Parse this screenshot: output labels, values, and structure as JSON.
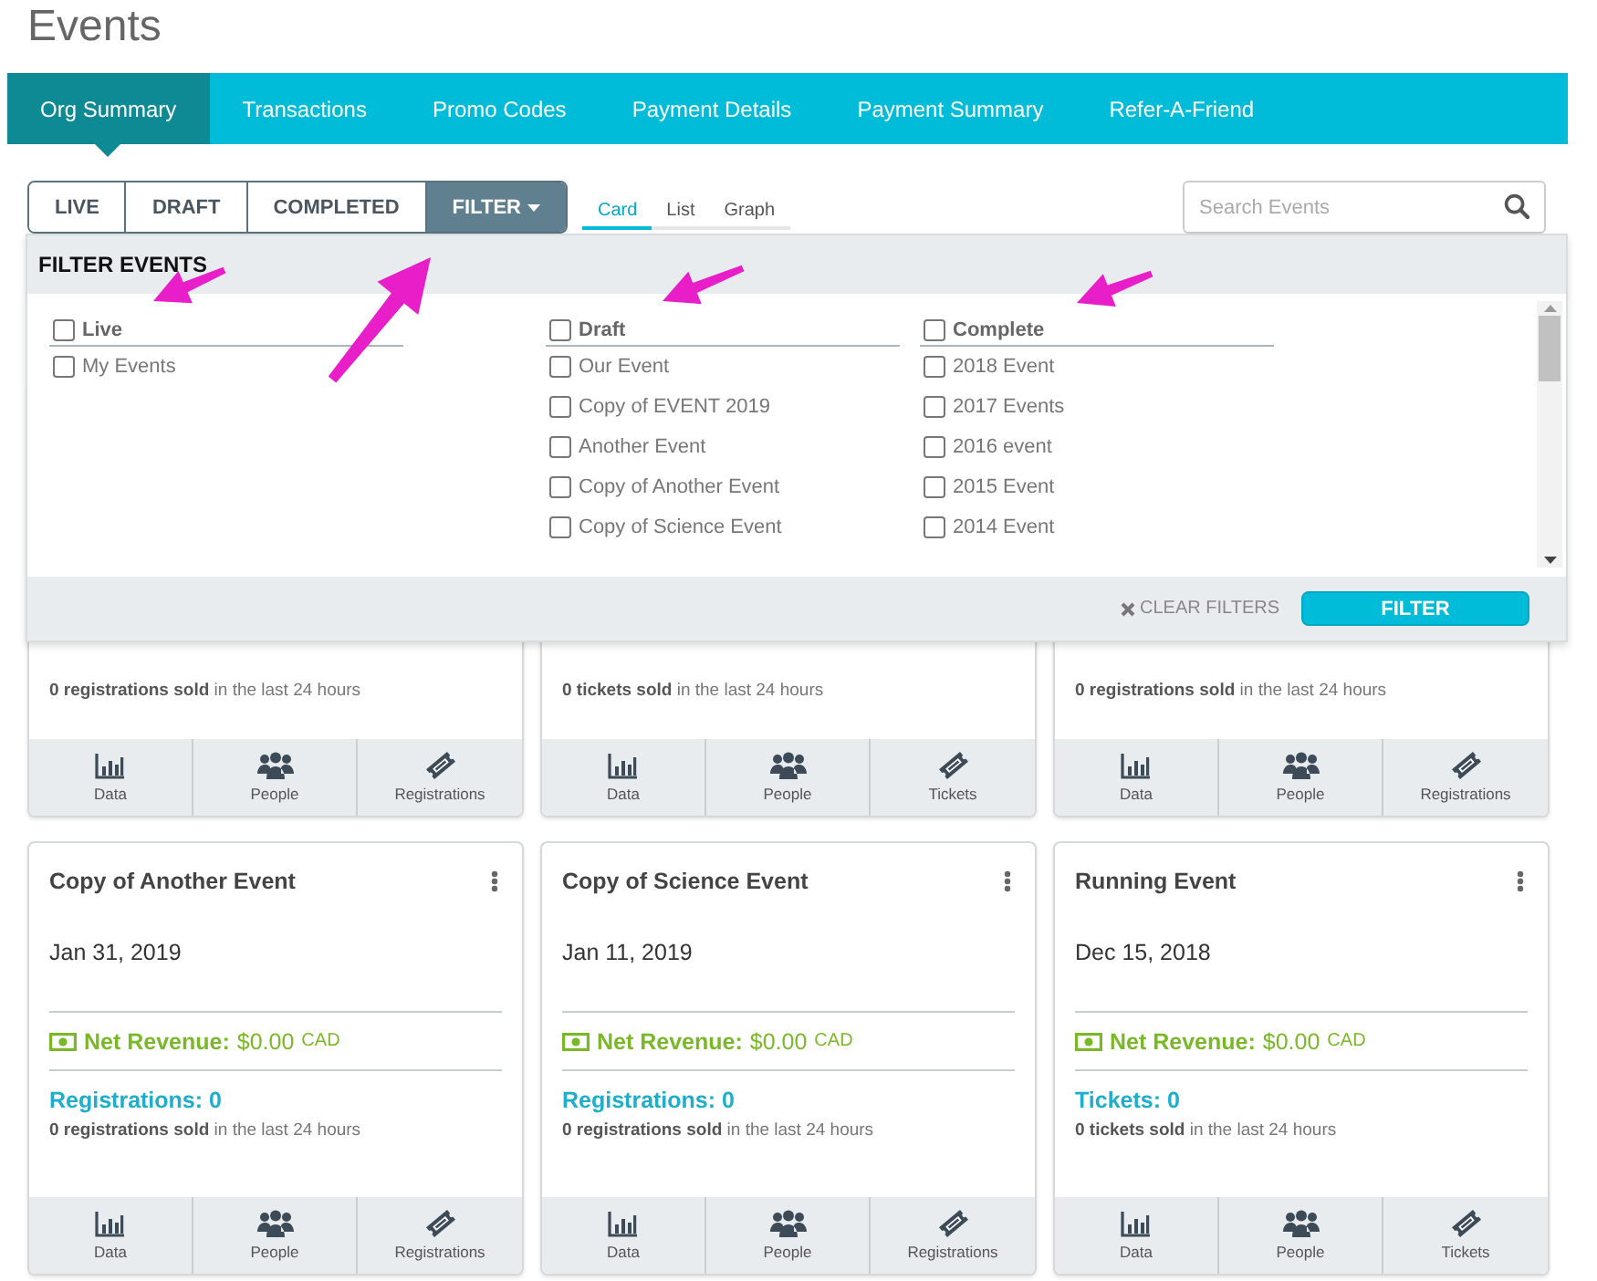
{
  "page_title": "Events",
  "nav_tabs": [
    {
      "label": "Org Summary",
      "selected": true
    },
    {
      "label": "Transactions",
      "selected": false
    },
    {
      "label": "Promo Codes",
      "selected": false
    },
    {
      "label": "Payment Details",
      "selected": false
    },
    {
      "label": "Payment Summary",
      "selected": false
    },
    {
      "label": "Refer-A-Friend",
      "selected": false
    }
  ],
  "status_buttons": [
    {
      "label": "LIVE",
      "selected": false
    },
    {
      "label": "DRAFT",
      "selected": false
    },
    {
      "label": "COMPLETED",
      "selected": false
    }
  ],
  "filter_button": {
    "label": "FILTER",
    "expanded": true
  },
  "view_tabs": [
    {
      "label": "Card",
      "selected": true
    },
    {
      "label": "List",
      "selected": false
    },
    {
      "label": "Graph",
      "selected": false
    }
  ],
  "search": {
    "placeholder": "Search Events"
  },
  "filter_panel": {
    "title": "FILTER EVENTS",
    "clear_label": "CLEAR FILTERS",
    "apply_label": "FILTER",
    "groups": [
      {
        "label": "Live",
        "checked": false,
        "items": [
          {
            "label": "My Events",
            "checked": false
          }
        ]
      },
      {
        "label": "Draft",
        "checked": false,
        "items": [
          {
            "label": "Our Event",
            "checked": false
          },
          {
            "label": "Copy of EVENT 2019",
            "checked": false
          },
          {
            "label": "Another Event",
            "checked": false
          },
          {
            "label": "Copy of Another Event",
            "checked": false
          },
          {
            "label": "Copy of Science Event",
            "checked": false
          }
        ]
      },
      {
        "label": "Complete",
        "checked": false,
        "items": [
          {
            "label": "2018 Event",
            "checked": false
          },
          {
            "label": "2017 Events",
            "checked": false
          },
          {
            "label": "2016 event",
            "checked": false
          },
          {
            "label": "2015 Event",
            "checked": false
          },
          {
            "label": "2014 Event",
            "checked": false
          }
        ]
      }
    ]
  },
  "cards": [
    {
      "sold": "**0 registrations sold** in the last 24 hours",
      "actions": [
        {
          "label": "Data",
          "kind": "chart"
        },
        {
          "label": "People",
          "kind": "people"
        },
        {
          "label": "Registrations",
          "kind": "ticket"
        }
      ]
    },
    {
      "sold": "**0 tickets sold** in the last 24 hours",
      "actions": [
        {
          "label": "Data",
          "kind": "chart"
        },
        {
          "label": "People",
          "kind": "people"
        },
        {
          "label": "Tickets",
          "kind": "ticket"
        }
      ]
    },
    {
      "sold": "**0 registrations sold** in the last 24 hours",
      "actions": [
        {
          "label": "Data",
          "kind": "chart"
        },
        {
          "label": "People",
          "kind": "people"
        },
        {
          "label": "Registrations",
          "kind": "ticket"
        }
      ]
    },
    {
      "title": "Copy of Another Event",
      "date": "Jan 31, 2019",
      "revenue_label": "Net Revenue:",
      "revenue_amount": "$0.00",
      "currency": "CAD",
      "count": "Registrations: 0",
      "sold": "**0 registrations sold** in the last 24 hours",
      "actions": [
        {
          "label": "Data",
          "kind": "chart"
        },
        {
          "label": "People",
          "kind": "people"
        },
        {
          "label": "Registrations",
          "kind": "ticket"
        }
      ]
    },
    {
      "title": "Copy of Science Event",
      "date": "Jan 11, 2019",
      "revenue_label": "Net Revenue:",
      "revenue_amount": "$0.00",
      "currency": "CAD",
      "count": "Registrations: 0",
      "sold": "**0 registrations sold** in the last 24 hours",
      "actions": [
        {
          "label": "Data",
          "kind": "chart"
        },
        {
          "label": "People",
          "kind": "people"
        },
        {
          "label": "Registrations",
          "kind": "ticket"
        }
      ]
    },
    {
      "title": "Running Event",
      "date": "Dec 15, 2018",
      "revenue_label": "Net Revenue:",
      "revenue_amount": "$0.00",
      "currency": "CAD",
      "count": "Tickets: 0",
      "sold": "**0 tickets sold** in the last 24 hours",
      "actions": [
        {
          "label": "Data",
          "kind": "chart"
        },
        {
          "label": "People",
          "kind": "people"
        },
        {
          "label": "Tickets",
          "kind": "ticket"
        }
      ]
    }
  ]
}
